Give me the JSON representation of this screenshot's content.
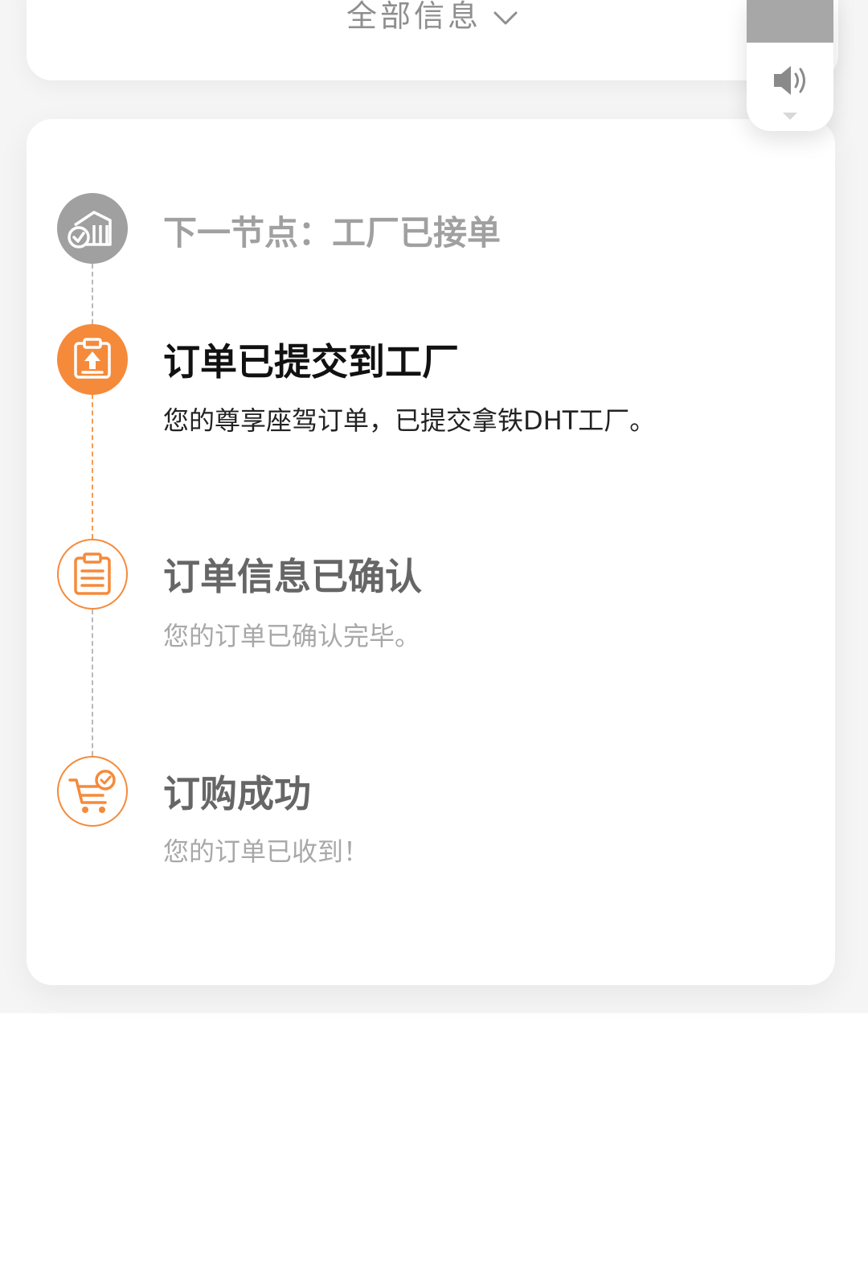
{
  "header": {
    "all_info_label": "全部信息",
    "chevron_icon": "chevron-down-icon"
  },
  "audio_widget": {
    "icon": "speaker-icon",
    "caret_icon": "caret-down-icon"
  },
  "timeline": {
    "next_node": {
      "label": "下一节点：工厂已接单",
      "icon": "factory-check-icon",
      "color": "#a0a0a0"
    },
    "steps": [
      {
        "title": "订单已提交到工厂",
        "description": "您的尊享座驾订单，已提交拿铁DHT工厂。",
        "icon": "clipboard-upload-icon",
        "state": "current",
        "color": "#f58a3a"
      },
      {
        "title": "订单信息已确认",
        "description": "您的订单已确认完毕。",
        "icon": "clipboard-list-icon",
        "state": "completed",
        "color": "#f58a3a"
      },
      {
        "title": "订购成功",
        "description": "您的订单已收到！",
        "icon": "cart-check-icon",
        "state": "completed",
        "color": "#f58a3a"
      }
    ]
  }
}
